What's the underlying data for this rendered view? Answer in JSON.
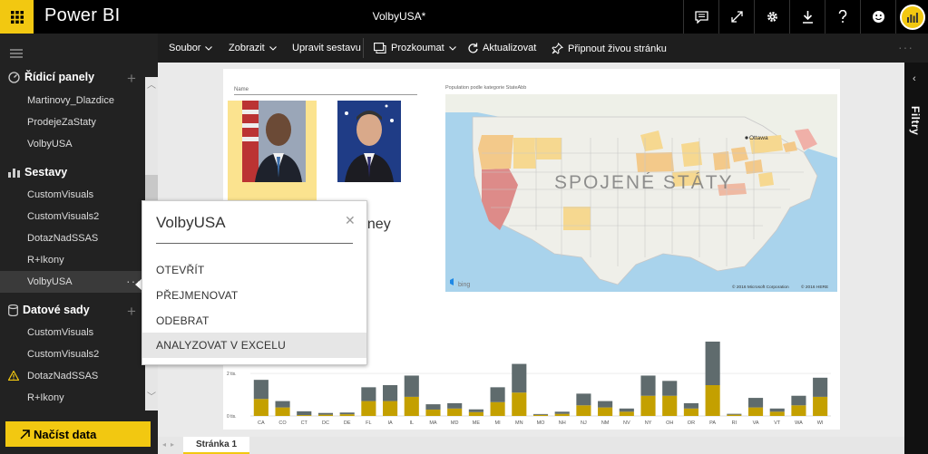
{
  "app": {
    "brand": "Power BI",
    "document_title": "VolbyUSA*"
  },
  "topbar_icons": [
    "comment-icon",
    "expand-icon",
    "gear-icon",
    "download-icon",
    "help-icon",
    "smiley-icon",
    "user-avatar-icon"
  ],
  "sidebar": {
    "dashboards": {
      "label": "Řídicí panely",
      "items": [
        "Martinovy_Dlazdice",
        "ProdejeZaStaty",
        "VolbyUSA"
      ]
    },
    "reports": {
      "label": "Sestavy",
      "items": [
        "CustomVisuals",
        "CustomVisuals2",
        "DotazNadSSAS",
        "R+Ikony",
        "VolbyUSA"
      ],
      "selected": "VolbyUSA"
    },
    "datasets": {
      "label": "Datové sady",
      "items": [
        "CustomVisuals",
        "CustomVisuals2",
        "DotazNadSSAS",
        "R+Ikony"
      ],
      "warning_item": "DotazNadSSAS"
    },
    "load_data": "Načíst data"
  },
  "toolbar": {
    "file": "Soubor",
    "view": "Zobrazit",
    "edit": "Upravit sestavu",
    "explore": "Prozkoumat",
    "refresh": "Aktualizovat",
    "pin": "Připnout živou stránku"
  },
  "report": {
    "name_label": "Name",
    "candidate2_name_partial": "nney",
    "map": {
      "label": "Population podle kategorie StateAbb",
      "country": "SPOJENÉ STÁTY",
      "city": "Ottawa",
      "copyright": "© 2016 Microsoft Corporation",
      "copyright2": "© 2016 HERE",
      "provider": "bing"
    }
  },
  "chart_data": {
    "type": "bar",
    "stacked": true,
    "categories": [
      "CA",
      "CO",
      "CT",
      "DC",
      "DE",
      "FL",
      "IA",
      "IL",
      "MA",
      "MD",
      "ME",
      "MI",
      "MN",
      "MO",
      "NH",
      "NJ",
      "NM",
      "NV",
      "NY",
      "OH",
      "OR",
      "PA",
      "RI",
      "VA",
      "VT",
      "WA",
      "WI"
    ],
    "y_tick_labels": [
      "0 tis.",
      "2 tis."
    ],
    "ylim": [
      0,
      3200
    ],
    "series": [
      {
        "color": "#C4A000",
        "values": [
          800,
          400,
          40,
          60,
          80,
          700,
          700,
          900,
          300,
          350,
          180,
          650,
          1100,
          50,
          100,
          500,
          400,
          200,
          950,
          950,
          350,
          1450,
          60,
          400,
          200,
          500,
          900
        ]
      },
      {
        "color": "#5F6B6D",
        "values": [
          900,
          300,
          180,
          80,
          80,
          650,
          750,
          1000,
          250,
          250,
          130,
          700,
          1350,
          40,
          100,
          550,
          300,
          150,
          950,
          700,
          250,
          2050,
          40,
          450,
          150,
          450,
          900
        ]
      }
    ]
  },
  "popup": {
    "title": "VolbyUSA",
    "items": [
      "OTEVŘÍT",
      "PŘEJMENOVAT",
      "ODEBRAT",
      "ANALYZOVAT V EXCELU"
    ],
    "highlighted": "ANALYZOVAT V EXCELU"
  },
  "filters_label": "Filtry",
  "page_tab": "Stránka 1",
  "colors": {
    "accent": "#F2C811",
    "dark": "#222222",
    "topbar": "#000000"
  }
}
